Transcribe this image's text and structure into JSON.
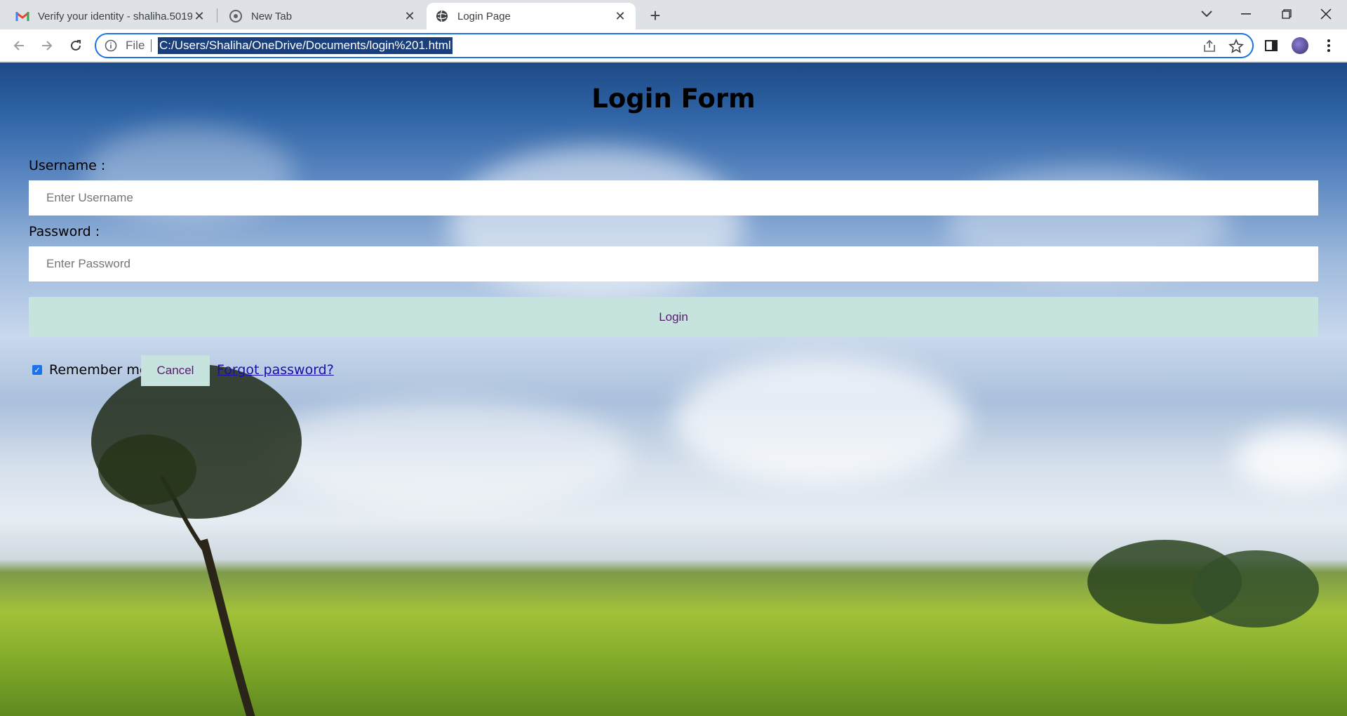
{
  "browser": {
    "tabs": [
      {
        "title": "Verify your identity - shaliha.5019",
        "icon": "gmail-icon",
        "active": false
      },
      {
        "title": "New Tab",
        "icon": "chrome-icon",
        "active": false
      },
      {
        "title": "Login Page",
        "icon": "globe-icon",
        "active": true
      }
    ],
    "omnibox": {
      "scheme_label": "File",
      "url": "C:/Users/Shaliha/OneDrive/Documents/login%201.html"
    }
  },
  "page": {
    "title": "Login Form",
    "username": {
      "label": "Username :",
      "placeholder": "Enter Username"
    },
    "password": {
      "label": "Password :",
      "placeholder": "Enter Password"
    },
    "login_label": "Login",
    "remember_label": "Remember me",
    "remember_checked": true,
    "cancel_label": "Cancel",
    "forgot_label": "Forgot password?"
  },
  "colors": {
    "button_bg": "#c6e3dd",
    "button_text": "#5a1970",
    "accent": "#1a73e8"
  }
}
